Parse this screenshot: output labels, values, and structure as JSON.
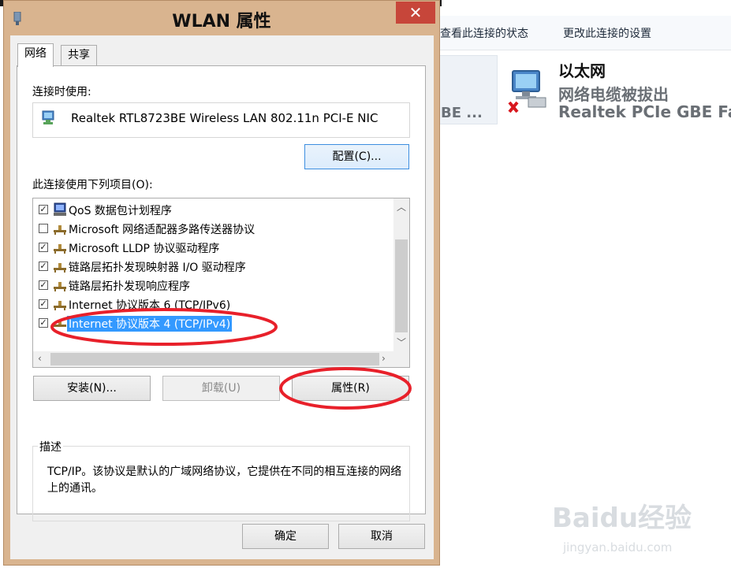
{
  "background": {
    "toolbar": {
      "view_status": "查看此连接的状态",
      "change_settings": "更改此连接的设置"
    },
    "left_adapter_partial": "BE ...",
    "ethernet": {
      "name": "以太网",
      "status": "网络电缆被拔出",
      "device": "Realtek PCIe GBE Fa..."
    },
    "watermark": {
      "text": "Baidu经验",
      "sub": "jingyan.baidu.com"
    }
  },
  "dialog": {
    "title": "WLAN 属性",
    "close_symbol": "✕",
    "tabs": [
      {
        "label": "网络",
        "active": true
      },
      {
        "label": "共享",
        "active": false
      }
    ],
    "connect_using_label": "连接时使用:",
    "adapter_name": "Realtek RTL8723BE Wireless LAN 802.11n PCI-E NIC",
    "configure_button": "配置(C)...",
    "items_label": "此连接使用下列项目(O):",
    "items": [
      {
        "label": "QoS 数据包计划程序",
        "checked": true,
        "icon": "qos-scheduler-icon"
      },
      {
        "label": "Microsoft 网络适配器多路传送器协议",
        "checked": false,
        "icon": "protocol-icon"
      },
      {
        "label": "Microsoft LLDP 协议驱动程序",
        "checked": true,
        "icon": "protocol-icon"
      },
      {
        "label": "链路层拓扑发现映射器 I/O 驱动程序",
        "checked": true,
        "icon": "protocol-icon"
      },
      {
        "label": "链路层拓扑发现响应程序",
        "checked": true,
        "icon": "protocol-icon"
      },
      {
        "label": "Internet 协议版本 6 (TCP/IPv6)",
        "checked": true,
        "icon": "protocol-icon"
      },
      {
        "label": "Internet 协议版本 4 (TCP/IPv4)",
        "checked": true,
        "icon": "protocol-icon",
        "selected": true
      }
    ],
    "install_button": "安装(N)...",
    "uninstall_button": "卸载(U)",
    "properties_button": "属性(R)",
    "description_legend": "描述",
    "description_text": "TCP/IP。该协议是默认的广域网络协议，它提供在不同的相互连接的网络上的通讯。",
    "ok_button": "确定",
    "cancel_button": "取消"
  },
  "colors": {
    "frame": "#d9b48f",
    "close": "#c7463a",
    "selection": "#3399ff",
    "annotation": "#e8202a"
  }
}
